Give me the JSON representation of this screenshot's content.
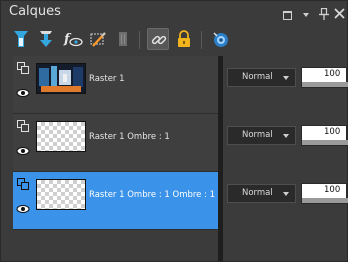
{
  "panel": {
    "title": "Calques"
  },
  "toolbar": {
    "tools": [
      {
        "icon": "new-raster-layer-icon"
      },
      {
        "icon": "new-vector-layer-icon"
      },
      {
        "icon": "visibility-toggle-icon"
      },
      {
        "icon": "rename-layer-icon"
      },
      {
        "icon": "delete-layer-icon"
      },
      {
        "icon": "link-layers-icon",
        "active": true
      },
      {
        "icon": "lock-transparency-icon"
      },
      {
        "icon": "layer-properties-icon"
      }
    ]
  },
  "layers": [
    {
      "name": "Raster 1",
      "thumbnail": "image",
      "blend_mode": "Normal",
      "opacity": "100",
      "opacity_fraction": 1.0,
      "selected": false
    },
    {
      "name": "Raster 1 Ombre : 1",
      "thumbnail": "transparent",
      "blend_mode": "Normal",
      "opacity": "100",
      "opacity_fraction": 1.0,
      "selected": false
    },
    {
      "name": "Raster 1 Ombre : 1 Ombre : 1",
      "thumbnail": "transparent",
      "blend_mode": "Normal",
      "opacity": "100",
      "opacity_fraction": 1.0,
      "selected": true
    }
  ],
  "colors": {
    "selection": "#3a93e8",
    "panel_background": "#3b3b3b"
  }
}
